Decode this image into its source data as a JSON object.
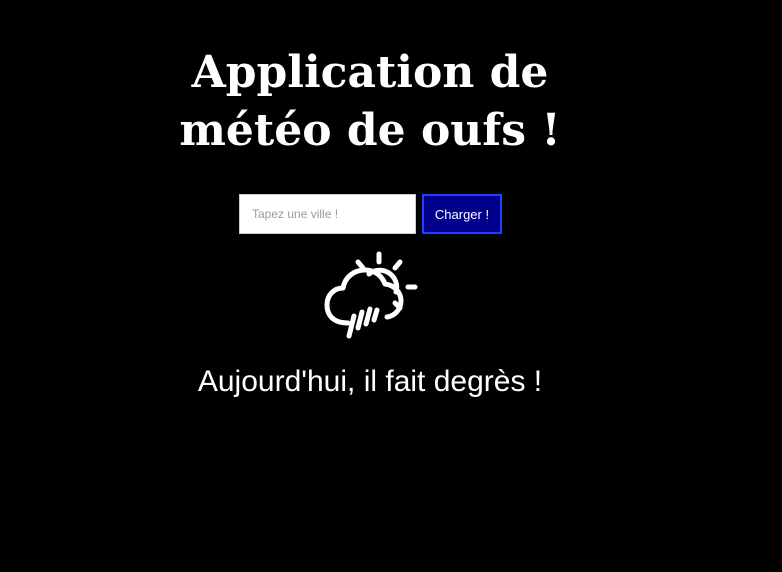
{
  "app": {
    "title_line1": "Application de",
    "title_line2": "météo de oufs !"
  },
  "search": {
    "placeholder": "Tapez une ville !",
    "value": "",
    "button_label": "Charger !"
  },
  "weather": {
    "icon": "rain-sun-icon",
    "temperature_text": "Aujourd'hui, il fait degrès !"
  },
  "colors": {
    "background": "#000000",
    "text": "#ffffff",
    "button_bg": "#00008b",
    "button_border": "#1f3fff"
  }
}
